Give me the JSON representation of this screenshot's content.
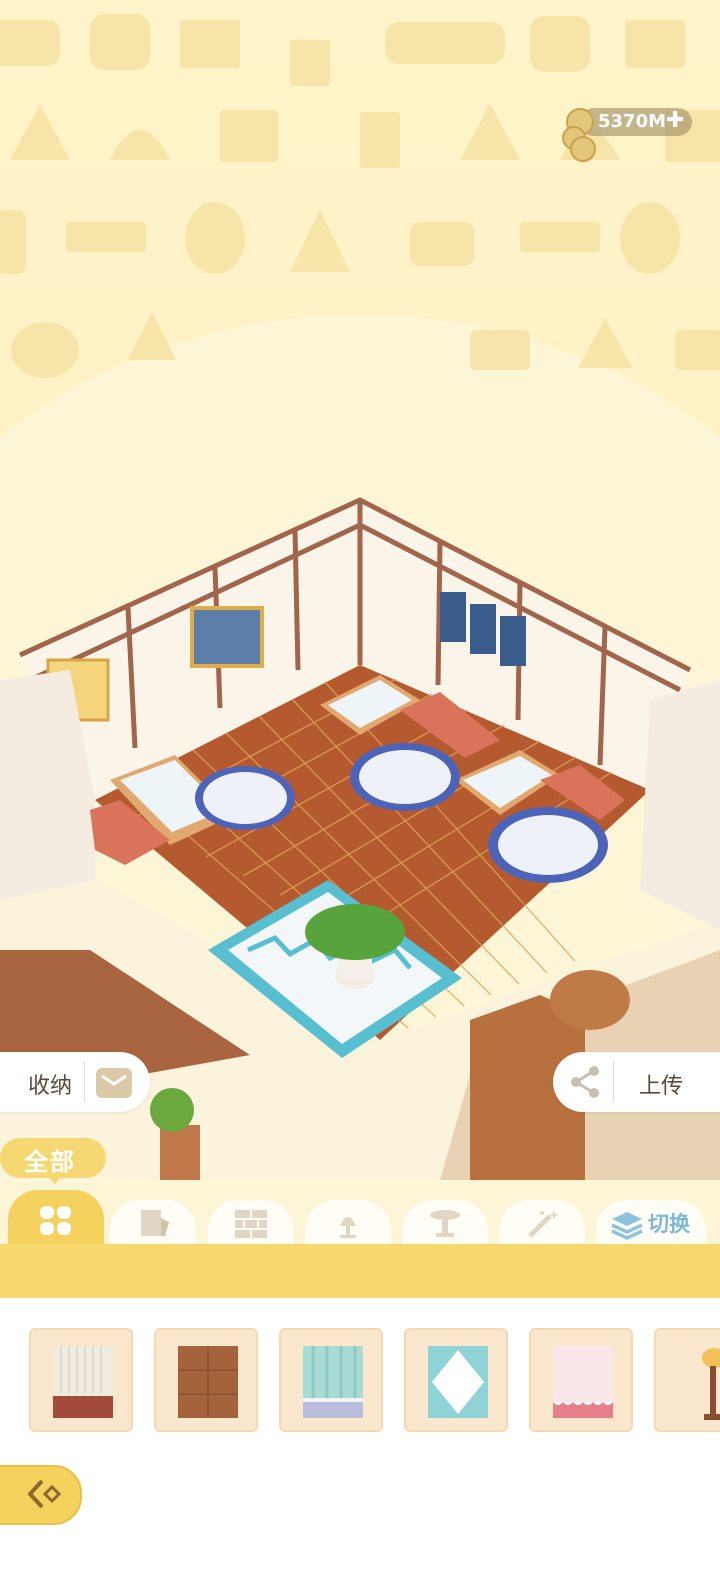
{
  "currency": {
    "amount": "5370M",
    "add_icon": "plus-icon"
  },
  "storage_button": {
    "label": "收纳",
    "icon": "storage-box-icon"
  },
  "upload_button": {
    "label": "上传",
    "icon": "share-icon"
  },
  "category": {
    "current_label": "全部"
  },
  "tabs": [
    {
      "id": "all",
      "icon": "clover-icon",
      "active": true
    },
    {
      "id": "wallpaper",
      "icon": "wallpaper-icon",
      "active": false
    },
    {
      "id": "floor",
      "icon": "brick-icon",
      "active": false
    },
    {
      "id": "lamp",
      "icon": "lamp-icon",
      "active": false
    },
    {
      "id": "table",
      "icon": "table-icon",
      "active": false
    },
    {
      "id": "effects",
      "icon": "magic-wand-icon",
      "active": false
    },
    {
      "id": "switch",
      "icon": "layers-icon",
      "label": "切换",
      "active": false
    }
  ],
  "items": [
    {
      "kind": "wallpaper",
      "colors": [
        "#f2ece0",
        "#a44a3a"
      ]
    },
    {
      "kind": "floor",
      "colors": [
        "#a5633c",
        "#8a4e2e"
      ]
    },
    {
      "kind": "wallpaper",
      "colors": [
        "#a9dbd6",
        "#b8bedc"
      ]
    },
    {
      "kind": "floor",
      "colors": [
        "#8fd3d7",
        "#ffffff"
      ]
    },
    {
      "kind": "wallpaper",
      "colors": [
        "#fbe6ea",
        "#e77f8a"
      ]
    },
    {
      "kind": "lamp",
      "colors": [
        "#f2c25a",
        "#8a4e2e"
      ]
    }
  ],
  "back_button": {
    "icon": "collapse-arrow-icon"
  },
  "colors": {
    "accent": "#f5d25e",
    "panel": "#ffffff",
    "tile": "#fbe7cd"
  }
}
